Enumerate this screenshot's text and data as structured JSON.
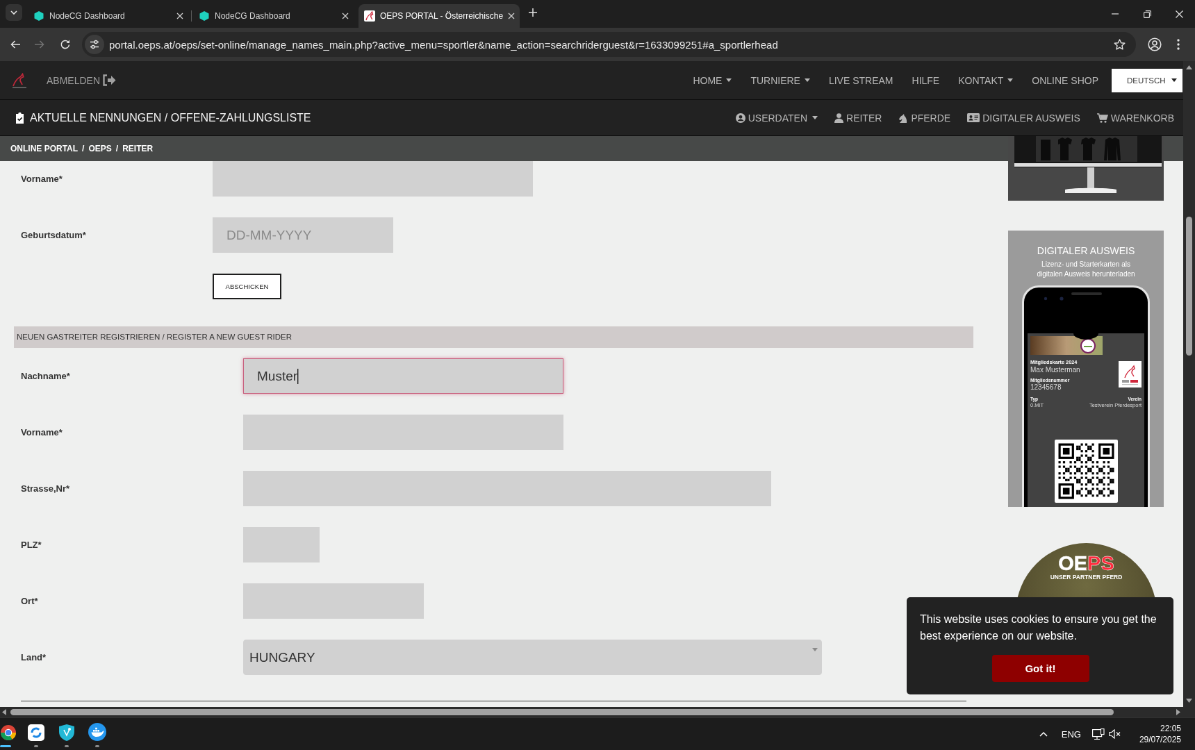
{
  "browser": {
    "tabs": [
      {
        "title": "NodeCG Dashboard",
        "kind": "hexagon",
        "selected": false
      },
      {
        "title": "NodeCG Dashboard",
        "kind": "hexagon",
        "selected": false
      },
      {
        "title": "OEPS PORTAL - Österreichische",
        "kind": "horse",
        "selected": true
      }
    ],
    "url": "portal.oeps.at/oeps/set-online/manage_names_main.php?active_menu=sportler&name_action=searchriderguest&r=1633099251#a_sportlerhead",
    "forward_enabled": false
  },
  "header": {
    "logout": "ABMELDEN",
    "nav": [
      {
        "label": "HOME",
        "dropdown": true
      },
      {
        "label": "TURNIERE",
        "dropdown": true
      },
      {
        "label": "LIVE STREAM",
        "dropdown": false
      },
      {
        "label": "HILFE",
        "dropdown": false
      },
      {
        "label": "KONTAKT",
        "dropdown": true
      },
      {
        "label": "ONLINE SHOP",
        "dropdown": false
      }
    ],
    "language": "DEUTSCH"
  },
  "title_bar": {
    "title": "AKTUELLE NENNUNGEN / OFFENE-ZAHLUNGSLISTE",
    "menu": [
      {
        "label": "USERDATEN",
        "kind": "account",
        "dropdown": true
      },
      {
        "label": "REITER",
        "kind": "rider",
        "dropdown": false
      },
      {
        "label": "PFERDE",
        "kind": "horse",
        "dropdown": false
      },
      {
        "label": "DIGITALER AUSWEIS",
        "kind": "card",
        "dropdown": false
      },
      {
        "label": "WARENKORB",
        "kind": "cart",
        "dropdown": false
      }
    ]
  },
  "breadcrumb": [
    {
      "label": "ONLINE PORTAL",
      "separator": "/"
    },
    {
      "label": "OEPS",
      "separator": "/"
    },
    {
      "label": "REITER"
    }
  ],
  "search_form": {
    "fields": [
      {
        "label": "Vorname*",
        "kind": "name"
      },
      {
        "label": "Geburtsdatum*",
        "kind": "date",
        "placeholder": "DD-MM-YYYY"
      }
    ],
    "submit": "ABSCHICKEN"
  },
  "guest_form": {
    "heading": "NEUEN GASTREITER REGISTRIEREN / REGISTER A NEW GUEST RIDER",
    "fields": [
      {
        "label": "Nachname*",
        "kind": "name",
        "value": "Muster",
        "focused": true
      },
      {
        "label": "Vorname*",
        "kind": "name",
        "focused": false
      },
      {
        "label": "Strasse,Nr*",
        "kind": "street",
        "focused": false
      },
      {
        "label": "PLZ*",
        "kind": "postcode",
        "focused": false
      },
      {
        "label": "Ort*",
        "kind": "city",
        "focused": false
      },
      {
        "label": "Land*",
        "kind": "country",
        "value": "HUNGARY",
        "focused": false
      }
    ]
  },
  "sidebar": {
    "ausweis_ad": {
      "title": "DIGITALER AUSWEIS",
      "subtitle": "Lizenz- und Starterkarten als digitalen Ausweis herunterladen",
      "card": {
        "title": "Mitgliedskarte 2024",
        "name": "Max Musterman",
        "number_label": "Mitgliedsnummer",
        "number": "12345678",
        "type_label": "Typ",
        "type": "0.MIT",
        "club_label": "Verein",
        "club": "Testverein Pferdesport"
      }
    },
    "partner_badge": {
      "logo": "OEPS",
      "tagline": "UNSER PARTNER PFERD"
    }
  },
  "cookie_banner": {
    "message": "This website uses cookies to ensure you get the best experience on our website.",
    "button": "Got it!"
  },
  "taskbar": {
    "apps": [
      {
        "kind": "browser",
        "selected": true
      },
      {
        "kind": "sync",
        "selected": false
      },
      {
        "kind": "shield",
        "selected": false
      },
      {
        "kind": "whale",
        "selected": false
      }
    ],
    "tray": {
      "language": "ENG",
      "muted": true,
      "time": "22:05",
      "date": "29/07/2025"
    }
  }
}
